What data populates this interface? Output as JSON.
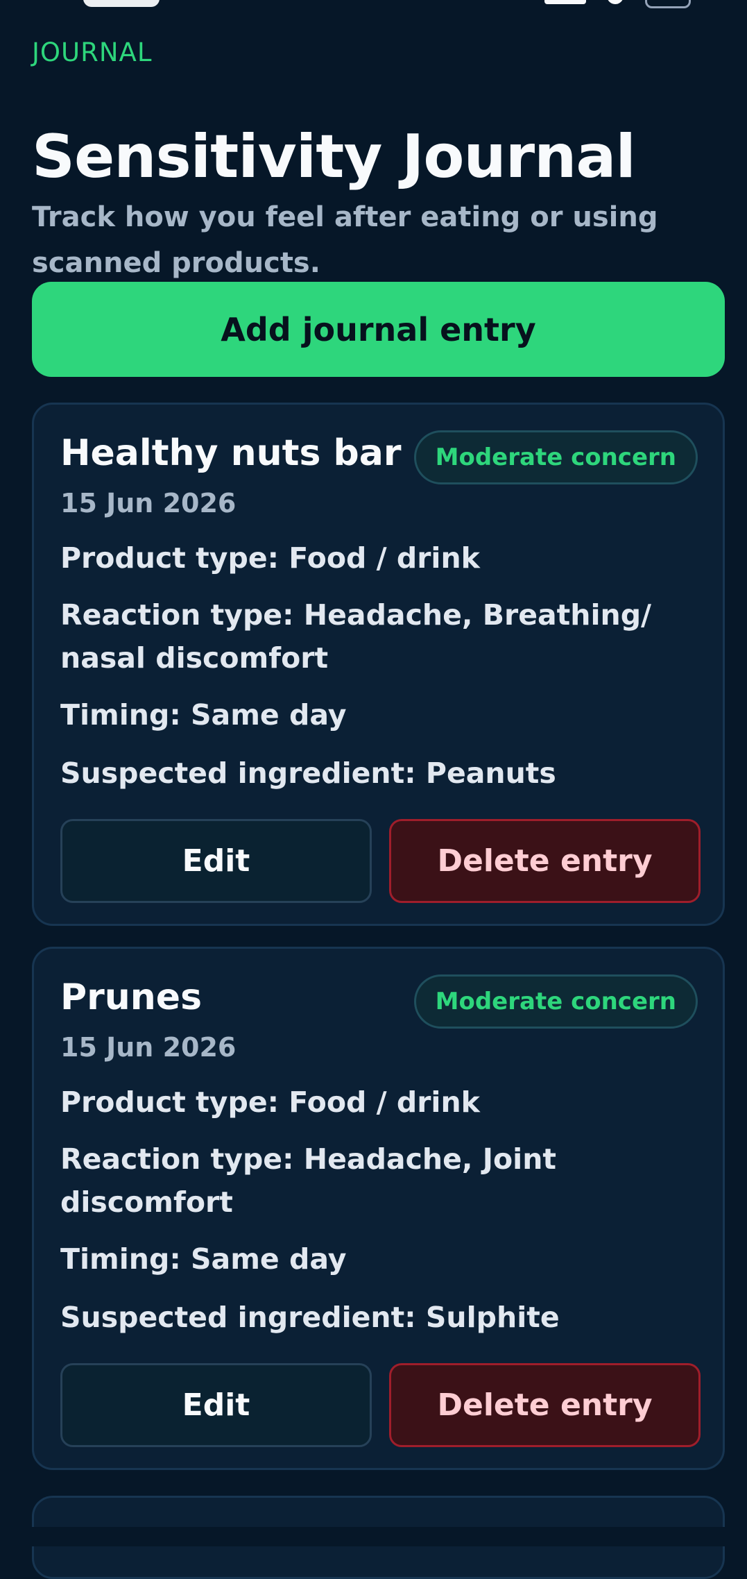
{
  "header": {
    "eyebrow": "JOURNAL",
    "title": "Sensitivity Journal",
    "subtitle": "Track how you feel after eating or using scanned products."
  },
  "actions": {
    "add_entry_label": "Add journal entry"
  },
  "entries": [
    {
      "product": "Healthy nuts  bar",
      "concern": "Moderate concern",
      "date": "15 Jun 2026",
      "product_type": "Product type: Food / drink",
      "reaction_type": "Reaction type: Headache, Breathing/ nasal discomfort",
      "timing": "Timing: Same day",
      "suspected_ingredient": "Suspected ingredient: Peanuts",
      "edit_label": "Edit",
      "delete_label": "Delete entry"
    },
    {
      "product": "Prunes",
      "concern": "Moderate concern",
      "date": "15 Jun 2026",
      "product_type": "Product type: Food / drink",
      "reaction_type": "Reaction type: Headache, Joint discomfort",
      "timing": "Timing: Same day",
      "suspected_ingredient": "Suspected ingredient: Sulphite",
      "edit_label": "Edit",
      "delete_label": "Delete entry"
    }
  ],
  "colors": {
    "background": "#061728",
    "card": "#0b2035",
    "accent": "#2ed67c",
    "delete": "#3b1117"
  },
  "icons": {
    "signal": "signal-icon",
    "wifi": "wifi-icon",
    "battery": "battery-icon"
  }
}
